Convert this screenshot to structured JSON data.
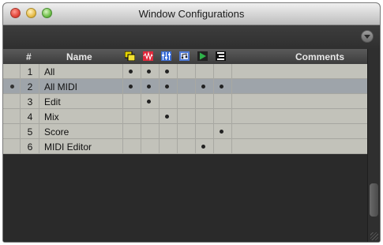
{
  "window": {
    "title": "Window Configurations"
  },
  "columns": {
    "number": "#",
    "name": "Name",
    "comments": "Comments"
  },
  "icons": [
    {
      "name": "edit-window-icon",
      "color": "#e6d400"
    },
    {
      "name": "mix-window-icon",
      "color": "#e0283b"
    },
    {
      "name": "mixer-faders-icon",
      "color": "#3d6fd8"
    },
    {
      "name": "score-window-icon",
      "color": "#4f7bd9"
    },
    {
      "name": "transport-play-icon",
      "color": "#2fb24a"
    },
    {
      "name": "midi-editor-icon",
      "color": "#222222"
    }
  ],
  "rows": [
    {
      "num": "1",
      "name": "All",
      "selected": false,
      "dots": [
        1,
        1,
        1,
        0,
        0,
        0
      ]
    },
    {
      "num": "2",
      "name": "All MIDI",
      "selected": true,
      "dots": [
        1,
        1,
        1,
        0,
        1,
        1
      ]
    },
    {
      "num": "3",
      "name": "Edit",
      "selected": false,
      "dots": [
        0,
        1,
        0,
        0,
        0,
        0
      ]
    },
    {
      "num": "4",
      "name": "Mix",
      "selected": false,
      "dots": [
        0,
        0,
        1,
        0,
        0,
        0
      ]
    },
    {
      "num": "5",
      "name": "Score",
      "selected": false,
      "dots": [
        0,
        0,
        0,
        0,
        0,
        1
      ]
    },
    {
      "num": "6",
      "name": "MIDI Editor",
      "selected": false,
      "dots": [
        0,
        0,
        0,
        0,
        1,
        0
      ]
    }
  ]
}
